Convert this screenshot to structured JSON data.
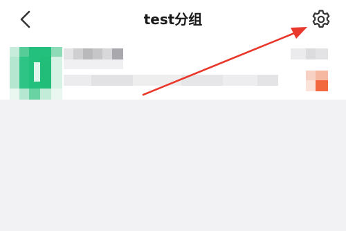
{
  "header": {
    "title": "test分组",
    "back_icon": "chevron-left-icon",
    "settings_icon": "gear-icon"
  },
  "contact_list": {
    "items": [
      {
        "avatar": "blurred-avatar",
        "name": "",
        "subtitle": "",
        "time": "",
        "badge_color": "#f2693f"
      }
    ]
  },
  "annotation": {
    "type": "red-arrow",
    "color": "#e8392c",
    "points_to": "settings-button"
  },
  "colors": {
    "header_bg": "#ffffff",
    "page_bg": "#f2f2f5",
    "avatar_green": "#21bf7c",
    "arrow_red": "#e8392c"
  }
}
